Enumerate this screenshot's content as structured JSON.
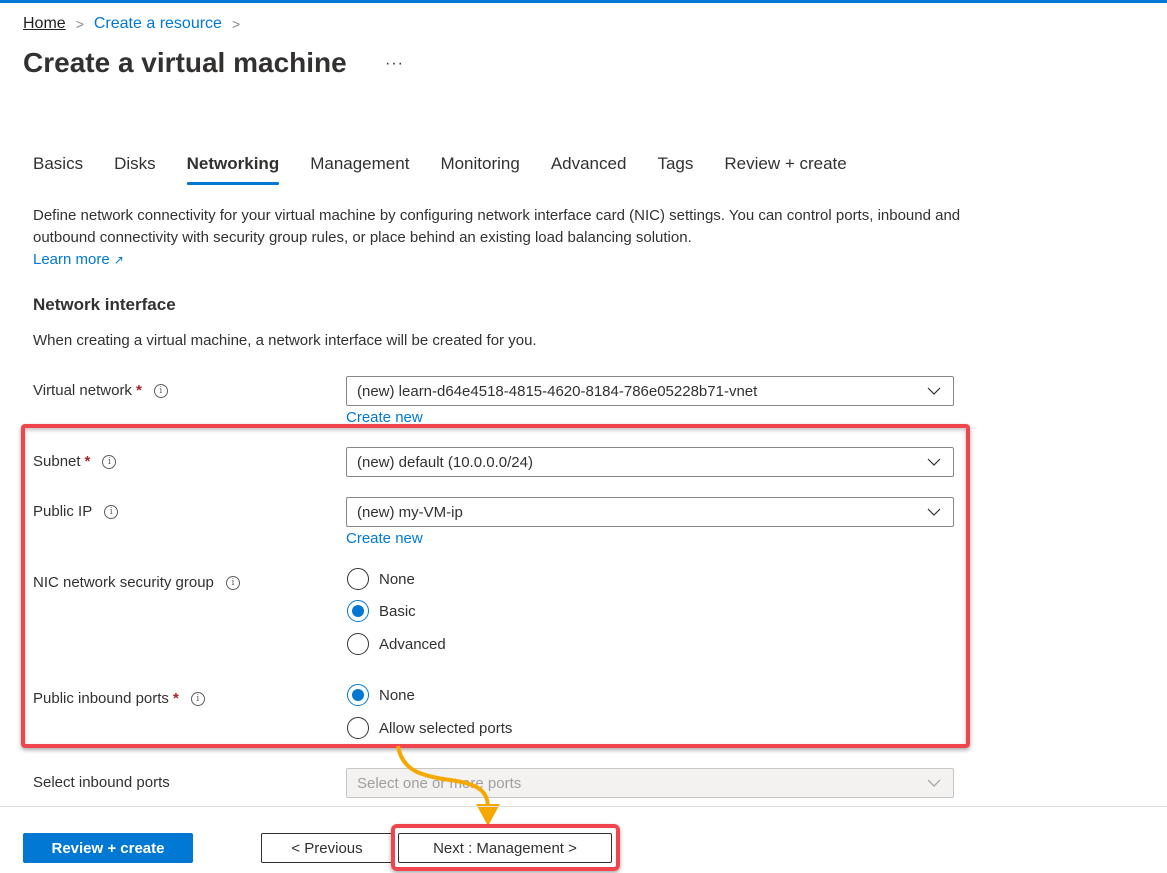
{
  "breadcrumb": {
    "items": [
      {
        "label": "Home"
      },
      {
        "label": "Create a resource"
      }
    ],
    "separator": ">"
  },
  "page": {
    "title": "Create a virtual machine",
    "more_label": "···"
  },
  "tabs": [
    {
      "label": "Basics",
      "active": false
    },
    {
      "label": "Disks",
      "active": false
    },
    {
      "label": "Networking",
      "active": true
    },
    {
      "label": "Management",
      "active": false
    },
    {
      "label": "Monitoring",
      "active": false
    },
    {
      "label": "Advanced",
      "active": false
    },
    {
      "label": "Tags",
      "active": false
    },
    {
      "label": "Review + create",
      "active": false
    }
  ],
  "description": {
    "text": "Define network connectivity for your virtual machine by configuring network interface card (NIC) settings. You can control ports, inbound and outbound connectivity with security group rules, or place behind an existing load balancing solution.",
    "learn_more": "Learn more",
    "learn_more_icon": "external-link-icon"
  },
  "network_interface": {
    "title": "Network interface",
    "description": "When creating a virtual machine, a network interface will be created for you."
  },
  "fields": {
    "virtual_network": {
      "label": "Virtual network",
      "required": "*",
      "value": "(new) learn-d64e4518-4815-4620-8184-786e05228b71-vnet",
      "create_new": "Create new"
    },
    "subnet": {
      "label": "Subnet",
      "required": "*",
      "value": "(new) default (10.0.0.0/24)"
    },
    "public_ip": {
      "label": "Public IP",
      "value": "(new) my-VM-ip",
      "create_new": "Create new"
    },
    "nic_nsg": {
      "label": "NIC network security group",
      "options": [
        {
          "label": "None",
          "checked": false
        },
        {
          "label": "Basic",
          "checked": true
        },
        {
          "label": "Advanced",
          "checked": false
        }
      ]
    },
    "public_inbound_ports": {
      "label": "Public inbound ports",
      "required": "*",
      "options": [
        {
          "label": "None",
          "checked": true
        },
        {
          "label": "Allow selected ports",
          "checked": false
        }
      ]
    },
    "select_inbound_ports": {
      "label": "Select inbound ports",
      "placeholder": "Select one or more ports"
    }
  },
  "footer": {
    "review_create": "Review + create",
    "previous": "< Previous",
    "next": "Next : Management >"
  },
  "colors": {
    "accent": "#0078d4",
    "highlight": "#f0454d",
    "arrow": "#f5a800"
  }
}
